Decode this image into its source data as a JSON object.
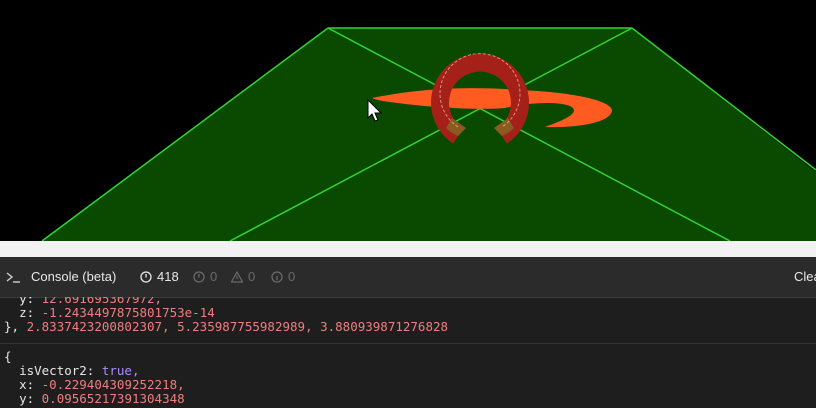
{
  "scene": {
    "ground_color": "#0a4a00",
    "edge_color": "#34d134",
    "object_color_top": "#a52019",
    "object_color_bottom": "#8a5a1e",
    "shadow_color": "#ff5a1f"
  },
  "toolbar": {
    "prompt_icon": "terminal-prompt-icon",
    "title": "Console (beta)",
    "messages_count": "418",
    "errors_count": "0",
    "warnings_count": "0",
    "info_count": "0",
    "clear_label": "Clea"
  },
  "log": {
    "line1_key": "y:",
    "line1_val": "12.691695367972,",
    "line2_key": "z:",
    "line2_val": "-1.2434497875801753e-14",
    "line3_close": "},",
    "line3_vals": "2.8337423200802307, 5.235987755982989, 3.880939871276828",
    "line4_open": "{",
    "line5_key": "isVector2:",
    "line5_val": "true,",
    "line6_key": "x:",
    "line6_val": "-0.229404309252218,",
    "line7_key": "y:",
    "line7_val": "0.09565217391304348"
  }
}
